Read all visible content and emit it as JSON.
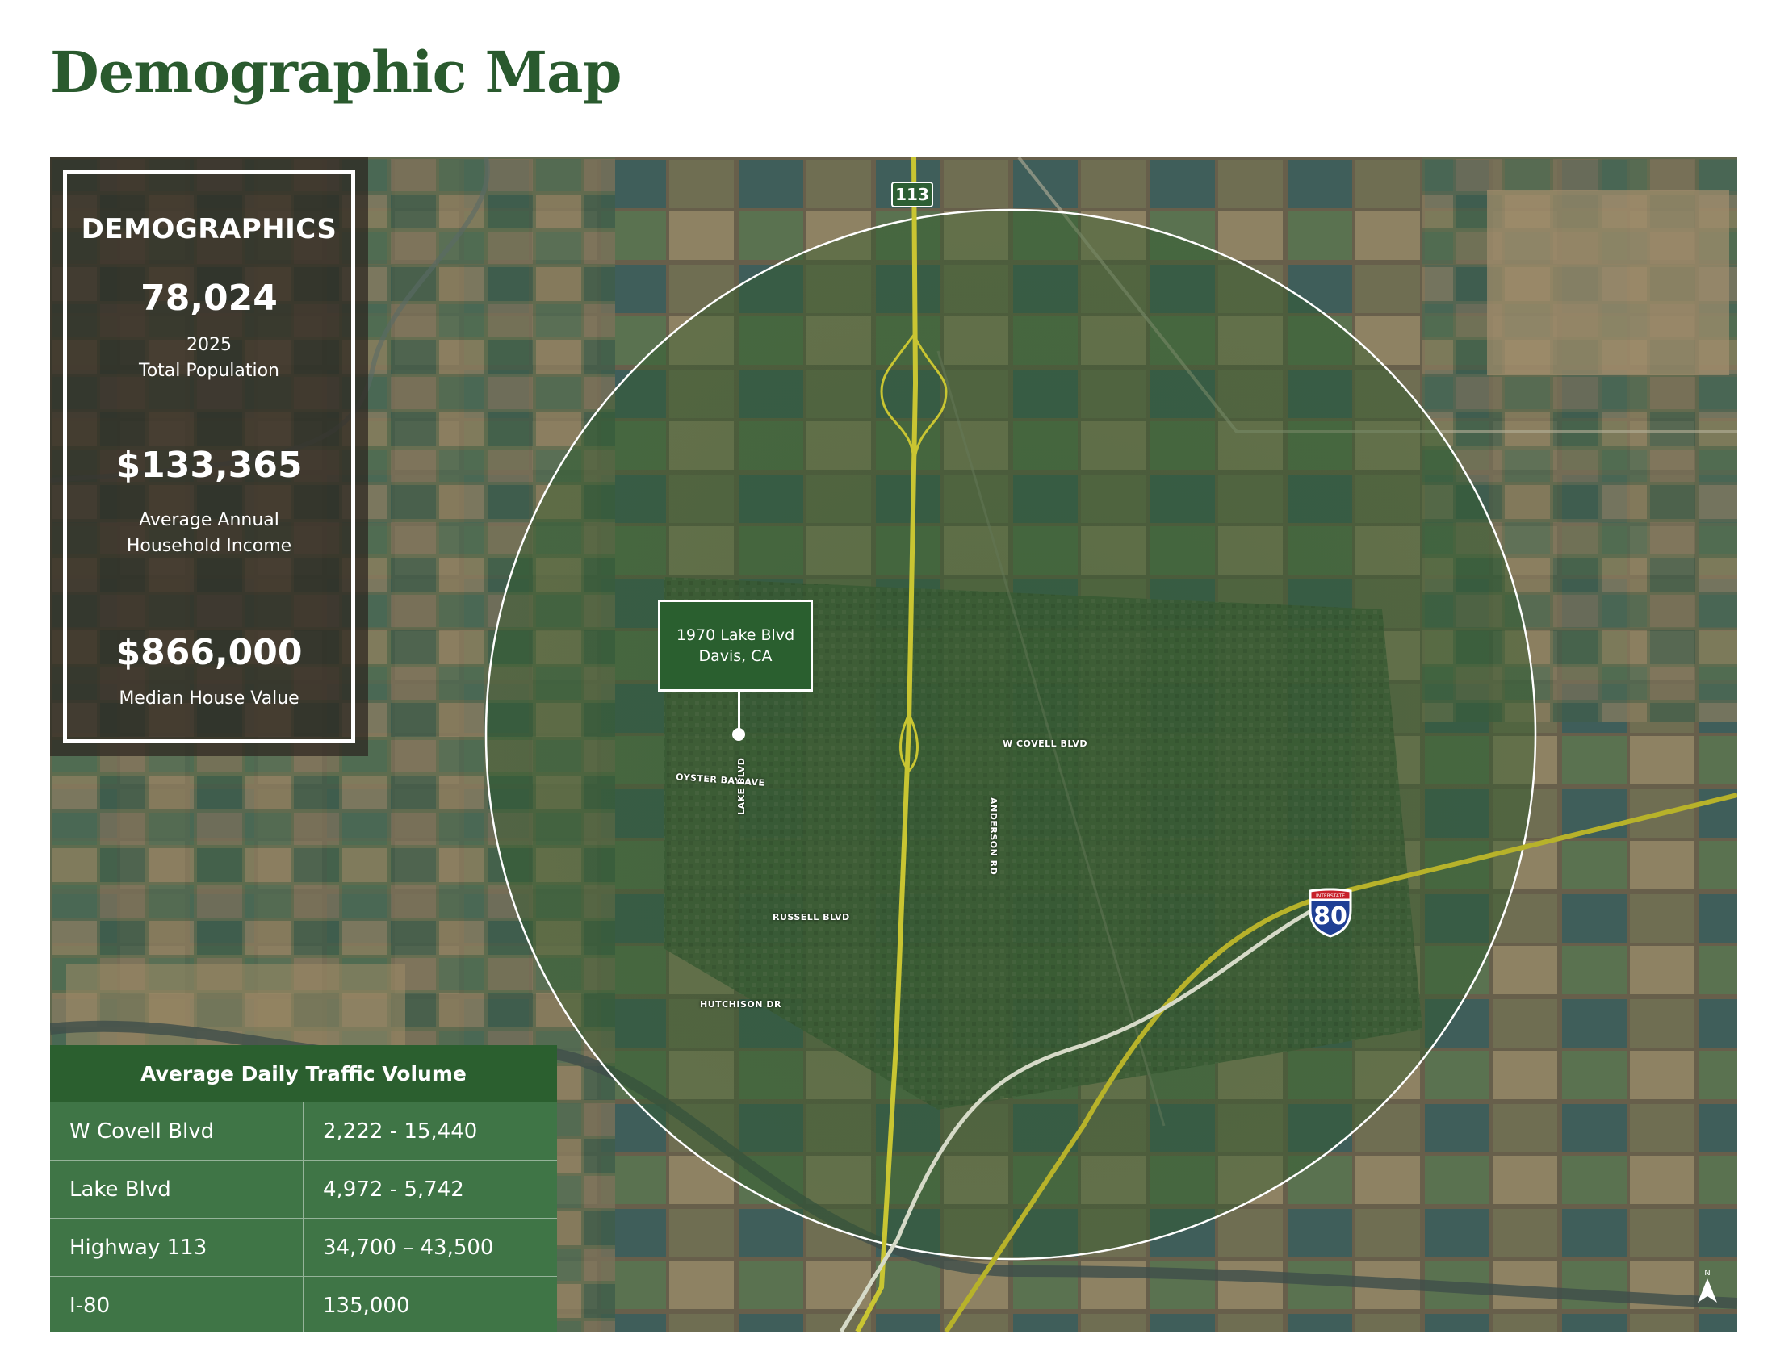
{
  "page": {
    "title": "Demographic Map"
  },
  "map": {
    "highway_shield_113": "113",
    "highway_shield_80": "80",
    "highway_shield_80_top": "INTERSTATE",
    "streets": {
      "w_covell": "W COVELL BLVD",
      "oyster_bay": "OYSTER BAY AVE",
      "lake": "LAKE BLVD",
      "anderson": "ANDERSON RD",
      "russell": "RUSSELL BLVD",
      "hutchison": "HUTCHISON DR"
    },
    "location": {
      "line1": "1970 Lake Blvd",
      "line2": "Davis, CA"
    },
    "north_label": "N",
    "colors": {
      "highway": "#c9c532",
      "ring": "#ffffff",
      "brand_green": "#2a5f2f"
    }
  },
  "demographics": {
    "heading": "DEMOGRAPHICS",
    "population": {
      "value": "78,024",
      "label_line1": "2025",
      "label_line2": "Total Population"
    },
    "income": {
      "value": "$133,365",
      "label_line1": "Average Annual",
      "label_line2": "Household Income"
    },
    "house_value": {
      "value": "$866,000",
      "label": "Median House Value"
    }
  },
  "traffic": {
    "heading": "Average Daily Traffic Volume",
    "rows": [
      {
        "road": "W Covell Blvd",
        "volume": "2,222 - 15,440"
      },
      {
        "road": "Lake Blvd",
        "volume": "4,972 - 5,742"
      },
      {
        "road": "Highway 113",
        "volume": "34,700 – 43,500"
      },
      {
        "road": "I-80",
        "volume": "135,000"
      }
    ]
  }
}
